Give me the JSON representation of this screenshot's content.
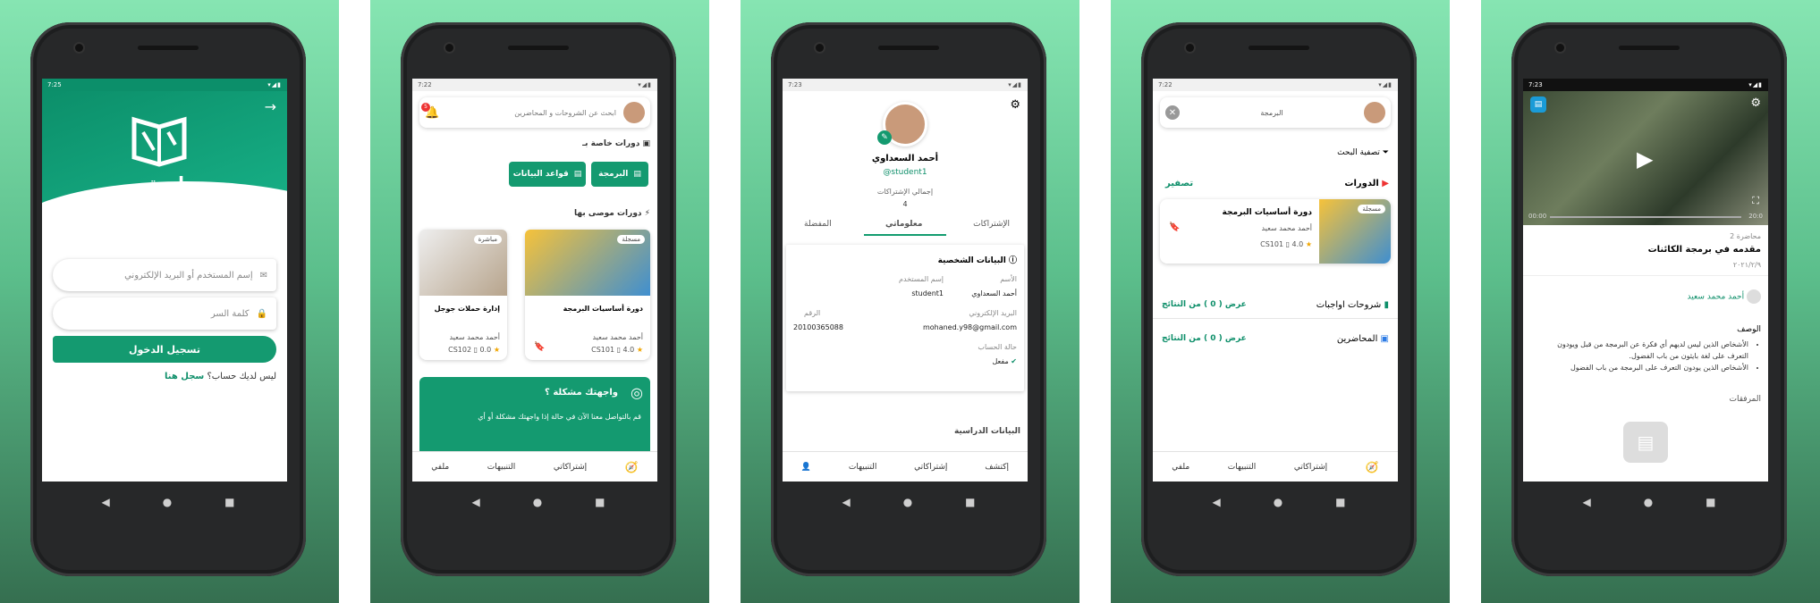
{
  "screens": [
    {
      "status_time": "7:25",
      "login": {
        "app_name": "جامعتي",
        "username_placeholder": "إسم المستخدم أو البريد الإلكتروني",
        "password_placeholder": "كلمة السر",
        "login_button": "تسجيل الدخول",
        "signup_text": "ليس لديك حساب؟",
        "signup_link": "سجل هنا"
      }
    },
    {
      "status_time": "7:22",
      "search_placeholder": "ابحث عن الشروحات و المحاضرين",
      "notification_count": "5",
      "section_special": "دورات خاصة بـ",
      "chips": [
        "البرمجة",
        "قواعد البيانات"
      ],
      "section_recommended": "دورات موصى بها",
      "courses": [
        {
          "title": "دورة أساسيات البرمجة",
          "author": "أحمد محمد سعيد",
          "rating": "4.0",
          "code": "CS101",
          "tag": "مسجلة"
        },
        {
          "title": "إدارة حملات جوجل",
          "author": "أحمد محمد سعيد",
          "rating": "0.0",
          "code": "CS102",
          "tag": "مباشرة"
        }
      ],
      "help_title": "واجهتك مشكلة ؟",
      "help_text": "قم بالتواصل معنا الآن في حالة إذا واجهتك مشكلة أو أي",
      "nav": [
        "إشتراكاتي",
        "التنبيهات",
        "ملفي"
      ]
    },
    {
      "status_time": "7:23",
      "profile": {
        "name": "أحمد السعداوي",
        "handle": "@student1",
        "subs_label": "إجمالي الإشتراكات",
        "subs_count": "4",
        "tabs": [
          "الإشتراكات",
          "معلوماتي",
          "المفضلة"
        ],
        "section_title": "البيانات الشخصية",
        "name_label": "الأسم",
        "name_value": "أحمد السعداوي",
        "username_label": "إسم المستخدم",
        "username_value": "student1",
        "email_label": "البريد الإلكتروني",
        "email_value": "mohaned.y98@gmail.com",
        "phone_label": "الرقم",
        "phone_value": "20100365088",
        "status_label": "حالة الحساب",
        "status_value": "مفعل",
        "section2": "البيانات الدراسية"
      },
      "nav": [
        "إكتشف",
        "إشتراكاتي",
        "التنبيهات"
      ]
    },
    {
      "status_time": "7:22",
      "search_value": "البرمجة",
      "filter_label": "تصفية البحث",
      "courses_label": "الدورات",
      "reset_label": "تصفير",
      "result": {
        "title": "دورة أساسيات البرمجة",
        "author": "أحمد محمد سعيد",
        "rating": "4.0",
        "code": "CS101",
        "tag": "مسجلة"
      },
      "homework_label": "شروحات اواجبات",
      "lecturers_label": "المحاضرين",
      "show_results": "عرض ( 0 ) من النتائج",
      "nav": [
        "إشتراكاتي",
        "التنبيهات",
        "ملفي"
      ]
    },
    {
      "status_time": "7:23",
      "video_time_left": "00:00",
      "video_time_right": "20:0",
      "lecture_no": "محاضرة 2",
      "lecture_title": "مقدمه في برمجة الكائنات",
      "lecture_date": "٢٠٢١/٢/٩",
      "instructor": "أحمد محمد سعيد",
      "desc_label": "الوصف",
      "bullets": [
        "الأشخاص الذين ليس لديهم أي فكرة عن البرمجة من قبل ويودون التعرف على لغة بايثون من باب الفضول.",
        "الأشخاص الذين يودون التعرف على البرمجة من باب الفضول"
      ],
      "attachments_label": "المرفقات"
    }
  ]
}
